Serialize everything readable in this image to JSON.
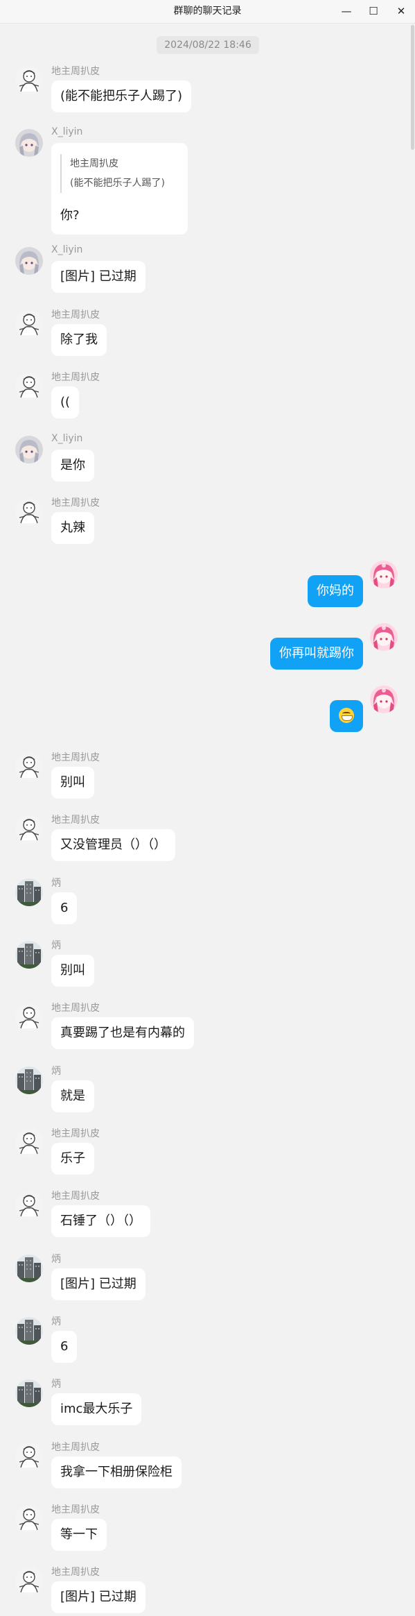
{
  "window": {
    "title": "群聊的聊天记录",
    "minimize": "—",
    "maximize": "☐",
    "close": "✕"
  },
  "timestamp": "2024/08/22 18:46",
  "messages": [
    {
      "sender": "地主周扒皮",
      "avatar": "sketch",
      "text": "(能不能把乐子人踢了)"
    },
    {
      "sender": "X_liyin",
      "avatar": "silver-hair",
      "quote_sender": "地主周扒皮",
      "quote_text": "(能不能把乐子人踢了)",
      "text": "你?"
    },
    {
      "sender": "X_liyin",
      "avatar": "silver-hair",
      "text": "[图片] 已过期"
    },
    {
      "sender": "地主周扒皮",
      "avatar": "sketch",
      "text": "除了我"
    },
    {
      "sender": "地主周扒皮",
      "avatar": "sketch",
      "text": "(("
    },
    {
      "sender": "X_liyin",
      "avatar": "silver-hair",
      "text": "是你"
    },
    {
      "sender": "地主周扒皮",
      "avatar": "sketch",
      "text": "丸辣"
    },
    {
      "sender": "",
      "avatar": "pink-hair",
      "text": "你妈的",
      "self": true
    },
    {
      "sender": "",
      "avatar": "pink-hair",
      "text": "你再叫就踢你",
      "self": true
    },
    {
      "sender": "",
      "avatar": "pink-hair",
      "text": "",
      "emoji": "grin-emoji",
      "self": true
    },
    {
      "sender": "地主周扒皮",
      "avatar": "sketch",
      "text": "别叫"
    },
    {
      "sender": "地主周扒皮",
      "avatar": "sketch",
      "text": "又没管理员（）（）"
    },
    {
      "sender": "炳",
      "avatar": "buildings",
      "text": "6"
    },
    {
      "sender": "炳",
      "avatar": "buildings",
      "text": "别叫"
    },
    {
      "sender": "地主周扒皮",
      "avatar": "sketch",
      "text": "真要踢了也是有内幕的"
    },
    {
      "sender": "炳",
      "avatar": "buildings",
      "text": "就是"
    },
    {
      "sender": "地主周扒皮",
      "avatar": "sketch",
      "text": "乐子"
    },
    {
      "sender": "地主周扒皮",
      "avatar": "sketch",
      "text": "石锤了（）（）"
    },
    {
      "sender": "炳",
      "avatar": "buildings",
      "text": "[图片] 已过期"
    },
    {
      "sender": "炳",
      "avatar": "buildings",
      "text": "6"
    },
    {
      "sender": "炳",
      "avatar": "buildings",
      "text": "imc最大乐子"
    },
    {
      "sender": "地主周扒皮",
      "avatar": "sketch",
      "text": "我拿一下相册保险柜"
    },
    {
      "sender": "地主周扒皮",
      "avatar": "sketch",
      "text": "等一下"
    },
    {
      "sender": "地主周扒皮",
      "avatar": "sketch",
      "text": "[图片] 已过期"
    }
  ]
}
